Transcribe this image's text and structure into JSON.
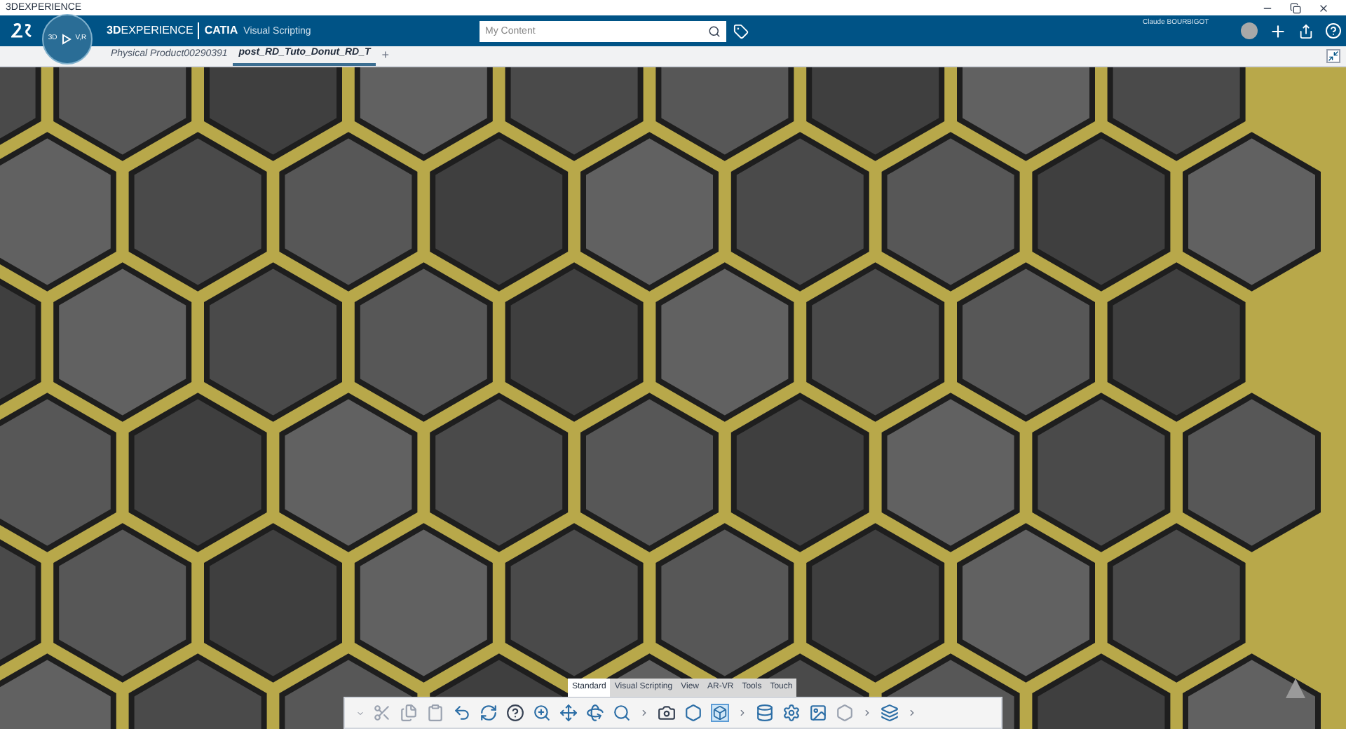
{
  "window": {
    "title": "3DEXPERIENCE"
  },
  "top_bar": {
    "brand_bold": "3D",
    "brand_rest": "EXPERIENCE",
    "app": "CATIA",
    "role": "Visual Scripting",
    "compass_labels": [
      "3D",
      "V,R"
    ],
    "search": {
      "placeholder": "My Content"
    },
    "user": "Claude BOURBIGOT"
  },
  "document_tabs": [
    {
      "label": "Physical Product00290391",
      "selected": false
    },
    {
      "label": "post_RD_Tuto_Donut_RD_T",
      "selected": true
    }
  ],
  "add_tab": "+",
  "toolbar_tabs": [
    {
      "label": "Standard",
      "selected": true
    },
    {
      "label": "Visual Scripting",
      "selected": false
    },
    {
      "label": "View",
      "selected": false
    },
    {
      "label": "AR-VR",
      "selected": false
    },
    {
      "label": "Tools",
      "selected": false
    },
    {
      "label": "Touch",
      "selected": false
    }
  ]
}
